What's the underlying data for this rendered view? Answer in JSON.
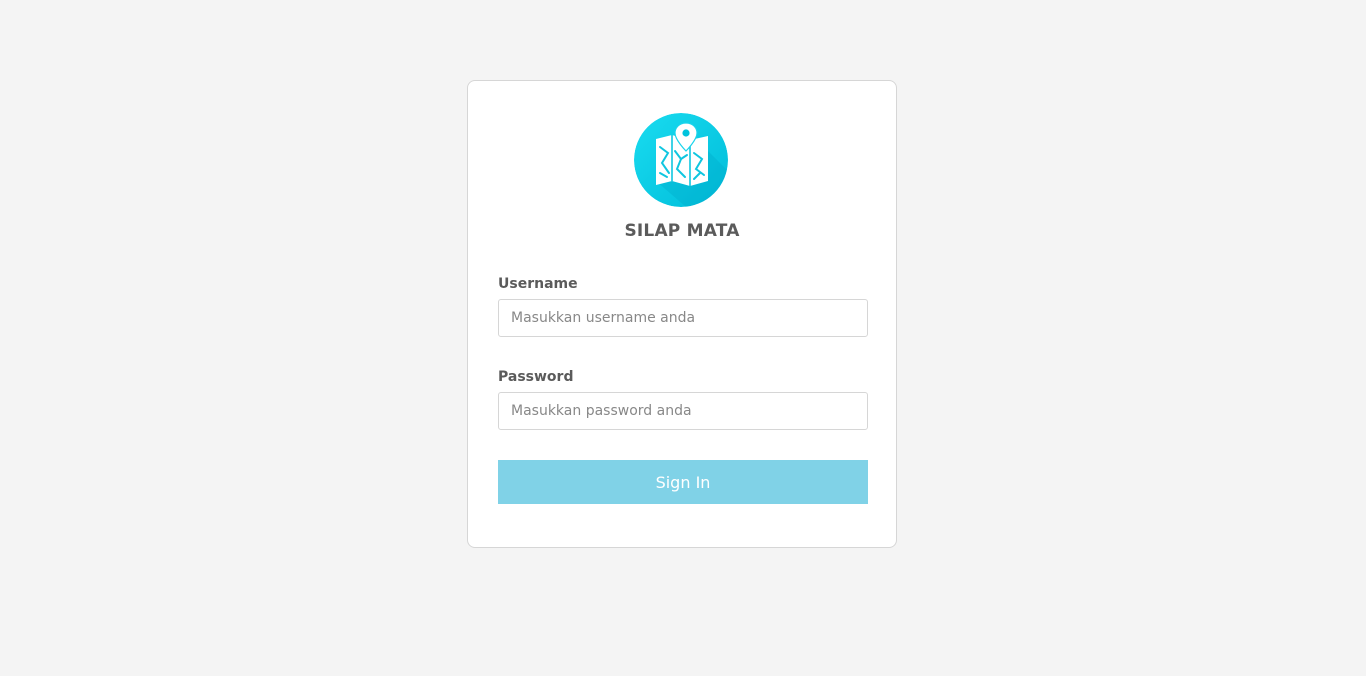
{
  "app": {
    "title": "SILAP MATA",
    "logo_icon": "map-location-icon"
  },
  "form": {
    "username": {
      "label": "Username",
      "placeholder": "Masukkan username anda",
      "value": ""
    },
    "password": {
      "label": "Password",
      "placeholder": "Masukkan password anda",
      "value": ""
    },
    "submit_label": "Sign In"
  },
  "colors": {
    "accent": "#00cfe8",
    "button": "#80d2e7",
    "background": "#f4f4f4"
  }
}
